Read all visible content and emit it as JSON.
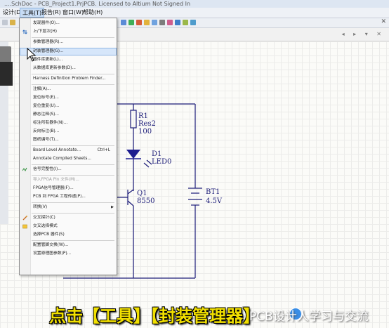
{
  "window": {
    "title_fragment": "....SchDoc - PCB_Project1.PrjPCB. Licensed to Altium Not Signed In"
  },
  "menubar": {
    "design": "设计(D)",
    "tools": "工具(T)",
    "reports": "报告(R)",
    "window": "窗口(W)",
    "help": "帮助(H)"
  },
  "menu": {
    "items": [
      {
        "label": "发现器件(O)...",
        "shortcut": "",
        "disabled": false
      },
      {
        "label": "上/下层次(H)",
        "shortcut": "",
        "disabled": false
      },
      {
        "label": "参数管理器(R)...",
        "shortcut": "",
        "disabled": false
      },
      {
        "label": "封装管理器(G)...",
        "shortcut": "",
        "disabled": false,
        "highlight": true
      },
      {
        "label": "器件库更新(L)...",
        "shortcut": "",
        "disabled": false
      },
      {
        "label": "从数据库更新参数(D)...",
        "shortcut": "",
        "disabled": false
      },
      {
        "label": "Harness Definition Problem Finder...",
        "shortcut": "",
        "disabled": false
      },
      {
        "label": "注解(A)...",
        "shortcut": "",
        "disabled": false
      },
      {
        "label": "复位标号(E)...",
        "shortcut": "",
        "disabled": false
      },
      {
        "label": "复位重复(U)...",
        "shortcut": "",
        "disabled": false
      },
      {
        "label": "静态注释(S)...",
        "shortcut": "",
        "disabled": false
      },
      {
        "label": "标注所有器件(N)...",
        "shortcut": "",
        "disabled": false
      },
      {
        "label": "反向标注(B)...",
        "shortcut": "",
        "disabled": false
      },
      {
        "label": "图纸编号(T)...",
        "shortcut": "",
        "disabled": false
      },
      {
        "label": "Board Level Annotate...",
        "shortcut": "Ctrl+L",
        "disabled": false
      },
      {
        "label": "Annotate Compiled Sheets...",
        "shortcut": "",
        "disabled": false
      },
      {
        "label": "信号完整性(I)...",
        "shortcut": "",
        "disabled": false
      },
      {
        "label": "导入FPGA Pin 文件(M)...",
        "shortcut": "",
        "disabled": true
      },
      {
        "label": "FPGA信号管理器(F)...",
        "shortcut": "",
        "disabled": false
      },
      {
        "label": "PCB 到 FPGA 工程传递(P)...",
        "shortcut": "",
        "disabled": false
      },
      {
        "label": "转换(V)",
        "shortcut": "",
        "disabled": false,
        "submenu": true
      },
      {
        "label": "交叉探针(C)",
        "shortcut": "",
        "disabled": false
      },
      {
        "label": "交叉选择模式",
        "shortcut": "",
        "disabled": false
      },
      {
        "label": "选择PCB 器件(S)",
        "shortcut": "",
        "disabled": false
      },
      {
        "label": "配置管脚交换(W)...",
        "shortcut": "",
        "disabled": false
      },
      {
        "label": "设置原理图参数(P)...",
        "shortcut": "",
        "disabled": false
      }
    ]
  },
  "schematic": {
    "r1_ref": "R1",
    "r1_type": "Res2",
    "r1_value": "100",
    "d1_ref": "D1",
    "d1_type": "LED0",
    "q1_ref": "Q1",
    "q1_type": "8550",
    "bt1_ref": "BT1",
    "bt1_value": "4.5V"
  },
  "caption": {
    "text": "点击【工具】【封装管理器】",
    "watermark": "PCB设计人学习与交流"
  },
  "colors": {
    "wire": "#1c1c78",
    "caption": "#f2e000",
    "highlight": "#d6e6fa",
    "led": "#1d1d8f"
  }
}
